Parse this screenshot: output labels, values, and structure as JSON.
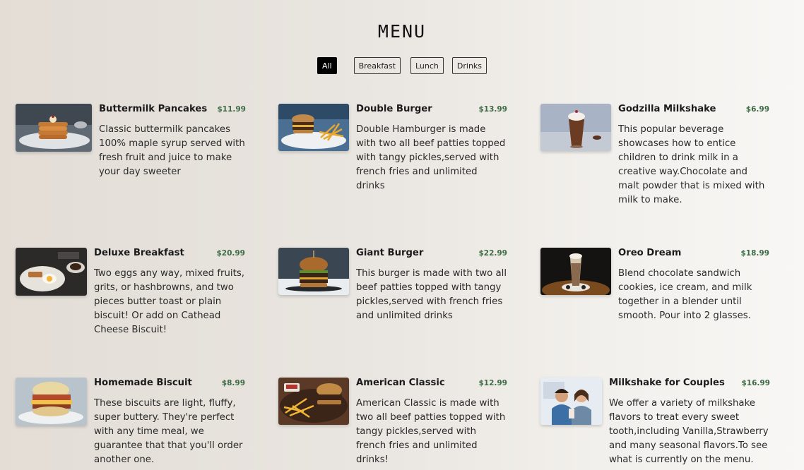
{
  "page": {
    "title": "MENU"
  },
  "filters": [
    {
      "label": "All"
    },
    {
      "label": "Breakfast"
    },
    {
      "label": "Lunch"
    },
    {
      "label": "Drinks"
    }
  ],
  "items": [
    {
      "name": "Buttermilk Pancakes",
      "price": "$11.99",
      "description": "Classic buttermilk pancakes 100% maple syrup served with fresh fruit and juice to make your day sweeter"
    },
    {
      "name": "Double Burger",
      "price": "$13.99",
      "description": "Double Hamburger is made with two all beef patties topped with tangy pickles,served with french fries and unlimited drinks"
    },
    {
      "name": "Godzilla Milkshake",
      "price": "$6.99",
      "description": "This popular beverage showcases how to entice children to drink milk in a creative way.Chocolate and malt powder that is mixed with milk to make."
    },
    {
      "name": "Deluxe Breakfast",
      "price": "$20.99",
      "description": "Two eggs any way, mixed fruits, grits, or hashbrowns, and two pieces butter toast or plain biscuit! Or add on Cathead Cheese Biscuit!"
    },
    {
      "name": "Giant Burger",
      "price": "$22.99",
      "description": "This burger is made with two all beef patties topped with tangy pickles,served with french fries and unlimited drinks"
    },
    {
      "name": "Oreo Dream",
      "price": "$18.99",
      "description": "Blend chocolate sandwich cookies, ice cream, and milk together in a blender until smooth. Pour into 2 glasses."
    },
    {
      "name": "Homemade Biscuit",
      "price": "$8.99",
      "description": "These biscuits are light, fluffy, super buttery. They're perfect with any time meal, we guarantee that that you'll order another one."
    },
    {
      "name": "American Classic",
      "price": "$12.99",
      "description": "American Classic is made with two all beef patties topped with tangy pickles,served with french fries and unlimited drinks!"
    },
    {
      "name": "Milkshake for Couples",
      "price": "$16.99",
      "description": "We offer a variety of milkshake flavors to treat every sweet tooth,including Vanilla,Strawberry and many seasonal flavors.To see what is currently on the menu."
    }
  ]
}
